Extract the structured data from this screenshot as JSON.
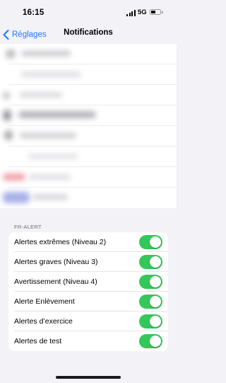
{
  "status_bar": {
    "time": "16:15",
    "network": "5G",
    "battery_level": 0.45
  },
  "nav": {
    "back_label": "Réglages",
    "title": "Notifications"
  },
  "fr_alert": {
    "header": "FR-ALERT",
    "items": [
      {
        "label": "Alertes extrêmes (Niveau 2)",
        "enabled": true
      },
      {
        "label": "Alertes graves (Niveau 3)",
        "enabled": true
      },
      {
        "label": "Avertissement (Niveau 4)",
        "enabled": true
      },
      {
        "label": "Alerte Enlèvement",
        "enabled": true
      },
      {
        "label": "Alertes d’exercice",
        "enabled": true
      },
      {
        "label": "Alertes de test",
        "enabled": true
      }
    ]
  },
  "colors": {
    "accent": "#1f78ff",
    "toggle_on": "#34c759",
    "background": "#f2f2f7"
  }
}
